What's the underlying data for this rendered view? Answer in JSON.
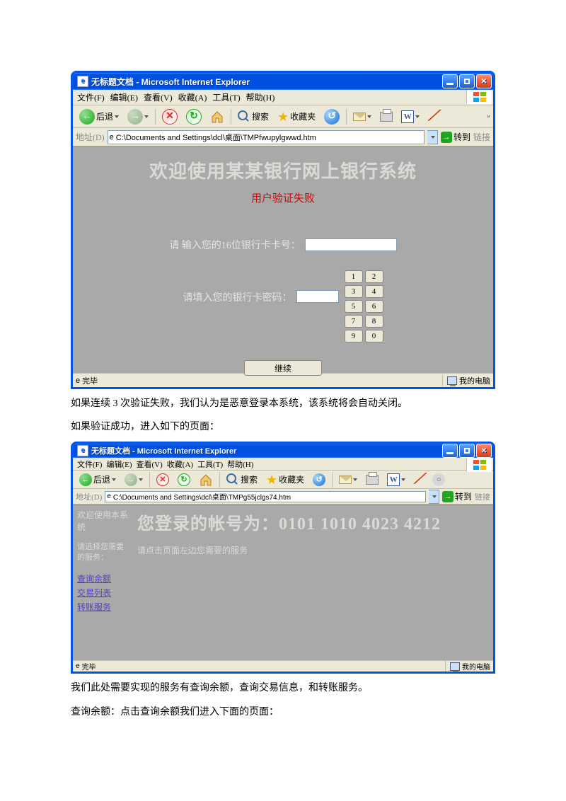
{
  "win1": {
    "title": "无标题文档 - Microsoft Internet Explorer",
    "menu": {
      "file": "文件(F)",
      "edit": "编辑(E)",
      "view": "查看(V)",
      "fav": "收藏(A)",
      "tools": "工具(T)",
      "help": "帮助(H)"
    },
    "toolbar": {
      "back": "后退",
      "search": "搜索",
      "fav": "收藏夹",
      "word": "W"
    },
    "address": {
      "label": "地址(D)",
      "value": "C:\\Documents and Settings\\dcl\\桌面\\TMPfwupylgwwd.htm",
      "go": "转到",
      "links": "链接"
    },
    "content": {
      "title": "欢迎使用某某银行网上银行系统",
      "fail": "用户验证失败",
      "card_label": "请  输入您的16位银行卡卡号：",
      "pwd_label": "请填入您的银行卡密码：",
      "continue": "继续",
      "keys": [
        "1",
        "2",
        "3",
        "4",
        "5",
        "6",
        "7",
        "8",
        "9",
        "0"
      ]
    },
    "status": {
      "done": "完毕",
      "zone": "我的电脑"
    }
  },
  "para1": "如果连续 3 次验证失败，我们认为是恶意登录本系统，该系统将会自动关闭。",
  "para2": "如果验证成功，进入如下的页面：",
  "win2": {
    "title": "无标题文档 - Microsoft Internet Explorer",
    "menu": {
      "file": "文件(F)",
      "edit": "编辑(E)",
      "view": "查看(V)",
      "fav": "收藏(A)",
      "tools": "工具(T)",
      "help": "帮助(H)"
    },
    "toolbar": {
      "back": "后退",
      "search": "搜索",
      "fav": "收藏夹",
      "word": "W"
    },
    "address": {
      "label": "地址(D)",
      "value": "C:\\Documents and Settings\\dcl\\桌面\\TMPg55jclgs74.htm",
      "go": "转到",
      "links": "链接"
    },
    "sidebar": {
      "welcome": "欢迎使用本系统",
      "select": "请选择您需要的服务：",
      "link1": "查询余额",
      "link2": "交易列表",
      "link3": "转账服务"
    },
    "main": {
      "acct_prefix": "您登录的帐号为：",
      "acct_num": "0101 1010 4023 4212",
      "instruction": "请点击页面左边您需要的服务"
    },
    "status": {
      "done": "完毕",
      "zone": "我的电脑"
    }
  },
  "para3": "我们此处需要实现的服务有查询余额，查询交易信息，和转账服务。",
  "para4": "查询余额：点击查询余额我们进入下面的页面："
}
